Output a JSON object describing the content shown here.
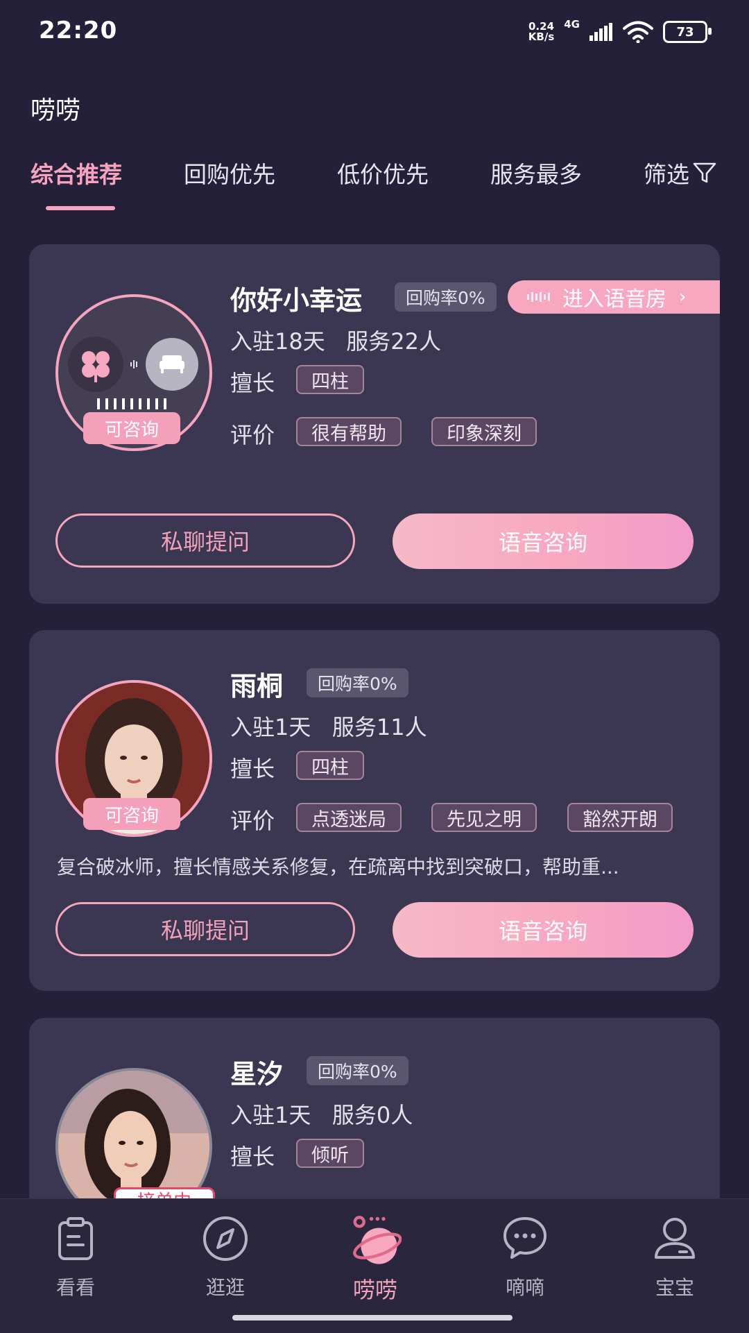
{
  "status_bar": {
    "time": "22:20",
    "net_speed_value": "0.24",
    "net_speed_unit": "KB/s",
    "net_type": "4G",
    "battery": "73"
  },
  "page_title": "唠唠",
  "tabs": [
    {
      "label": "综合推荐",
      "active": true
    },
    {
      "label": "回购优先",
      "active": false
    },
    {
      "label": "低价优先",
      "active": false
    },
    {
      "label": "服务最多",
      "active": false
    },
    {
      "label": "筛选",
      "active": false
    }
  ],
  "labels": {
    "specialty": "擅长",
    "review": "评价",
    "chat_button": "私聊提问",
    "voice_button": "语音咨询",
    "voice_room": "进入语音房",
    "consult_badge": "可咨询"
  },
  "consultants": [
    {
      "name": "你好小幸运",
      "repurchase_rate": "回购率0%",
      "joined": "入驻18天",
      "served": "服务22人",
      "specialties": [
        "四柱"
      ],
      "reviews": [
        "很有帮助",
        "印象深刻"
      ],
      "description": "",
      "status": "可咨询"
    },
    {
      "name": "雨桐",
      "repurchase_rate": "回购率0%",
      "joined": "入驻1天",
      "served": "服务11人",
      "specialties": [
        "四柱"
      ],
      "reviews": [
        "点透迷局",
        "先见之明",
        "豁然开朗"
      ],
      "description": "复合破冰师，擅长情感关系修复，在疏离中找到突破口，帮助重...",
      "status": "可咨询"
    },
    {
      "name": "星汐",
      "repurchase_rate": "回购率0%",
      "joined": "入驻1天",
      "served": "服务0人",
      "specialties": [
        "倾听"
      ],
      "reviews": [],
      "description": "",
      "status": "接单中"
    }
  ],
  "bottom_nav": [
    {
      "label": "看看",
      "icon": "clipboard-icon",
      "active": false
    },
    {
      "label": "逛逛",
      "icon": "compass-icon",
      "active": false
    },
    {
      "label": "唠唠",
      "icon": "planet-icon",
      "active": true
    },
    {
      "label": "嘀嘀",
      "icon": "chat-bubble-icon",
      "active": false
    },
    {
      "label": "宝宝",
      "icon": "user-icon",
      "active": false
    }
  ],
  "colors": {
    "background": "#24203a",
    "card": "#3b3651",
    "accent_pink": "#f7a3bd"
  }
}
